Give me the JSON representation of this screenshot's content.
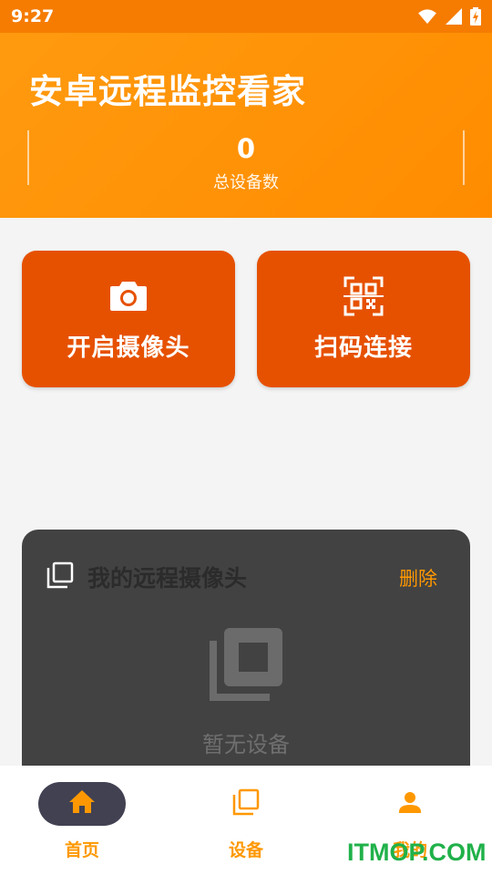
{
  "status_bar": {
    "time": "9:27"
  },
  "header": {
    "title": "安卓远程监控看家",
    "stat_value": "0",
    "stat_label": "总设备数"
  },
  "actions": {
    "camera_label": "开启摄像头",
    "scan_label": "扫码连接"
  },
  "devices_panel": {
    "title": "我的远程摄像头",
    "delete_label": "删除",
    "empty_text": "暂无设备"
  },
  "bottom_nav": {
    "items": [
      {
        "label": "首页",
        "icon": "home-icon",
        "active": true
      },
      {
        "label": "设备",
        "icon": "devices-icon",
        "active": false
      },
      {
        "label": "我的",
        "icon": "person-icon",
        "active": false
      }
    ]
  },
  "watermark": "ITMOP.COM",
  "colors": {
    "header": "#ff9a0f",
    "action_card": "#e65100",
    "accent": "#ff9800",
    "panel": "#424242"
  }
}
